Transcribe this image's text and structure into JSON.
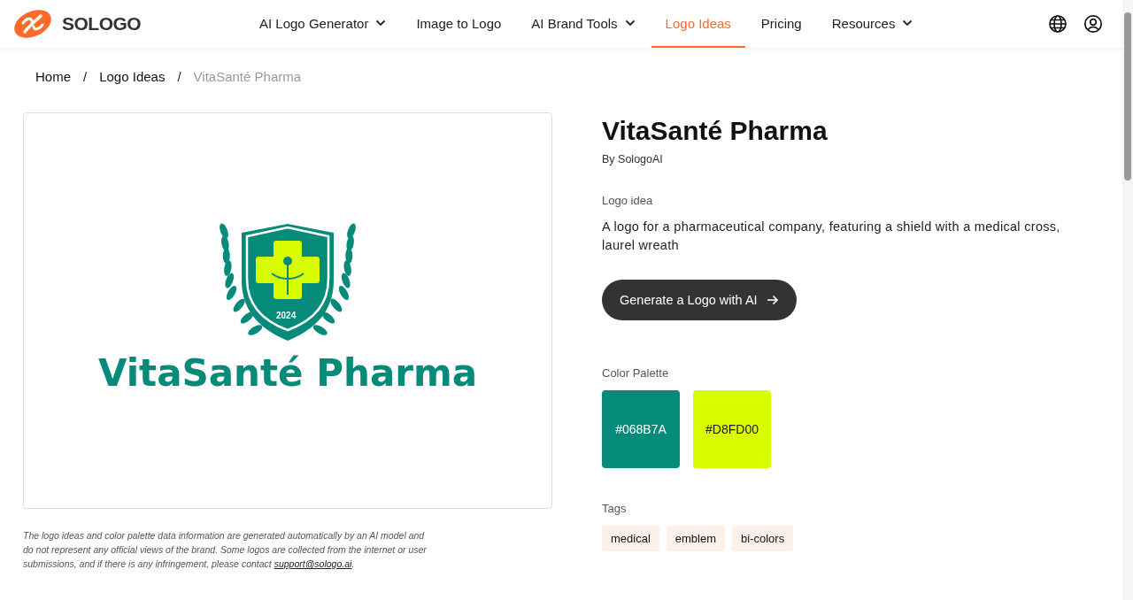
{
  "header": {
    "brand": "SOLOGO",
    "nav": [
      {
        "label": "AI Logo Generator",
        "dropdown": true,
        "selected": false
      },
      {
        "label": "Image to Logo",
        "dropdown": false,
        "selected": false
      },
      {
        "label": "AI Brand Tools",
        "dropdown": true,
        "selected": false
      },
      {
        "label": "Logo Ideas",
        "dropdown": false,
        "selected": true
      },
      {
        "label": "Pricing",
        "dropdown": false,
        "selected": false
      },
      {
        "label": "Resources",
        "dropdown": true,
        "selected": false
      }
    ]
  },
  "breadcrumb": [
    {
      "label": "Home",
      "current": false
    },
    {
      "separator": "/",
      "label": "Logo Ideas",
      "current": false
    },
    {
      "separator": "/",
      "label": "VitaSanté Pharma",
      "current": true
    }
  ],
  "logo_image": {
    "wordmark": "VitaSanté Pharma",
    "year": "2024"
  },
  "disclaimer": {
    "text": "The logo ideas and color palette data information are generated automatically by an AI model and do not represent any official views of the brand. Some logos are collected from the internet or user submissions, and if there is any infringement, please contact ",
    "link": "support@sologo.ai",
    "end": "."
  },
  "title": "VitaSanté Pharma",
  "author": "By SologoAI",
  "idea_label": "Logo idea",
  "idea": "A logo for a pharmaceutical company, featuring a shield with a medical cross, laurel wreath",
  "cta": "Generate a Logo with AI",
  "palette_label": "Color Palette",
  "palette": [
    {
      "label": "#068B7A",
      "color": "#068b7a",
      "dark": true
    },
    {
      "label": "#D8FD00",
      "color": "#d8fd00",
      "dark": false
    }
  ],
  "tags_label": "Tags",
  "tags": [
    "medical",
    "emblem",
    "bi-colors"
  ]
}
